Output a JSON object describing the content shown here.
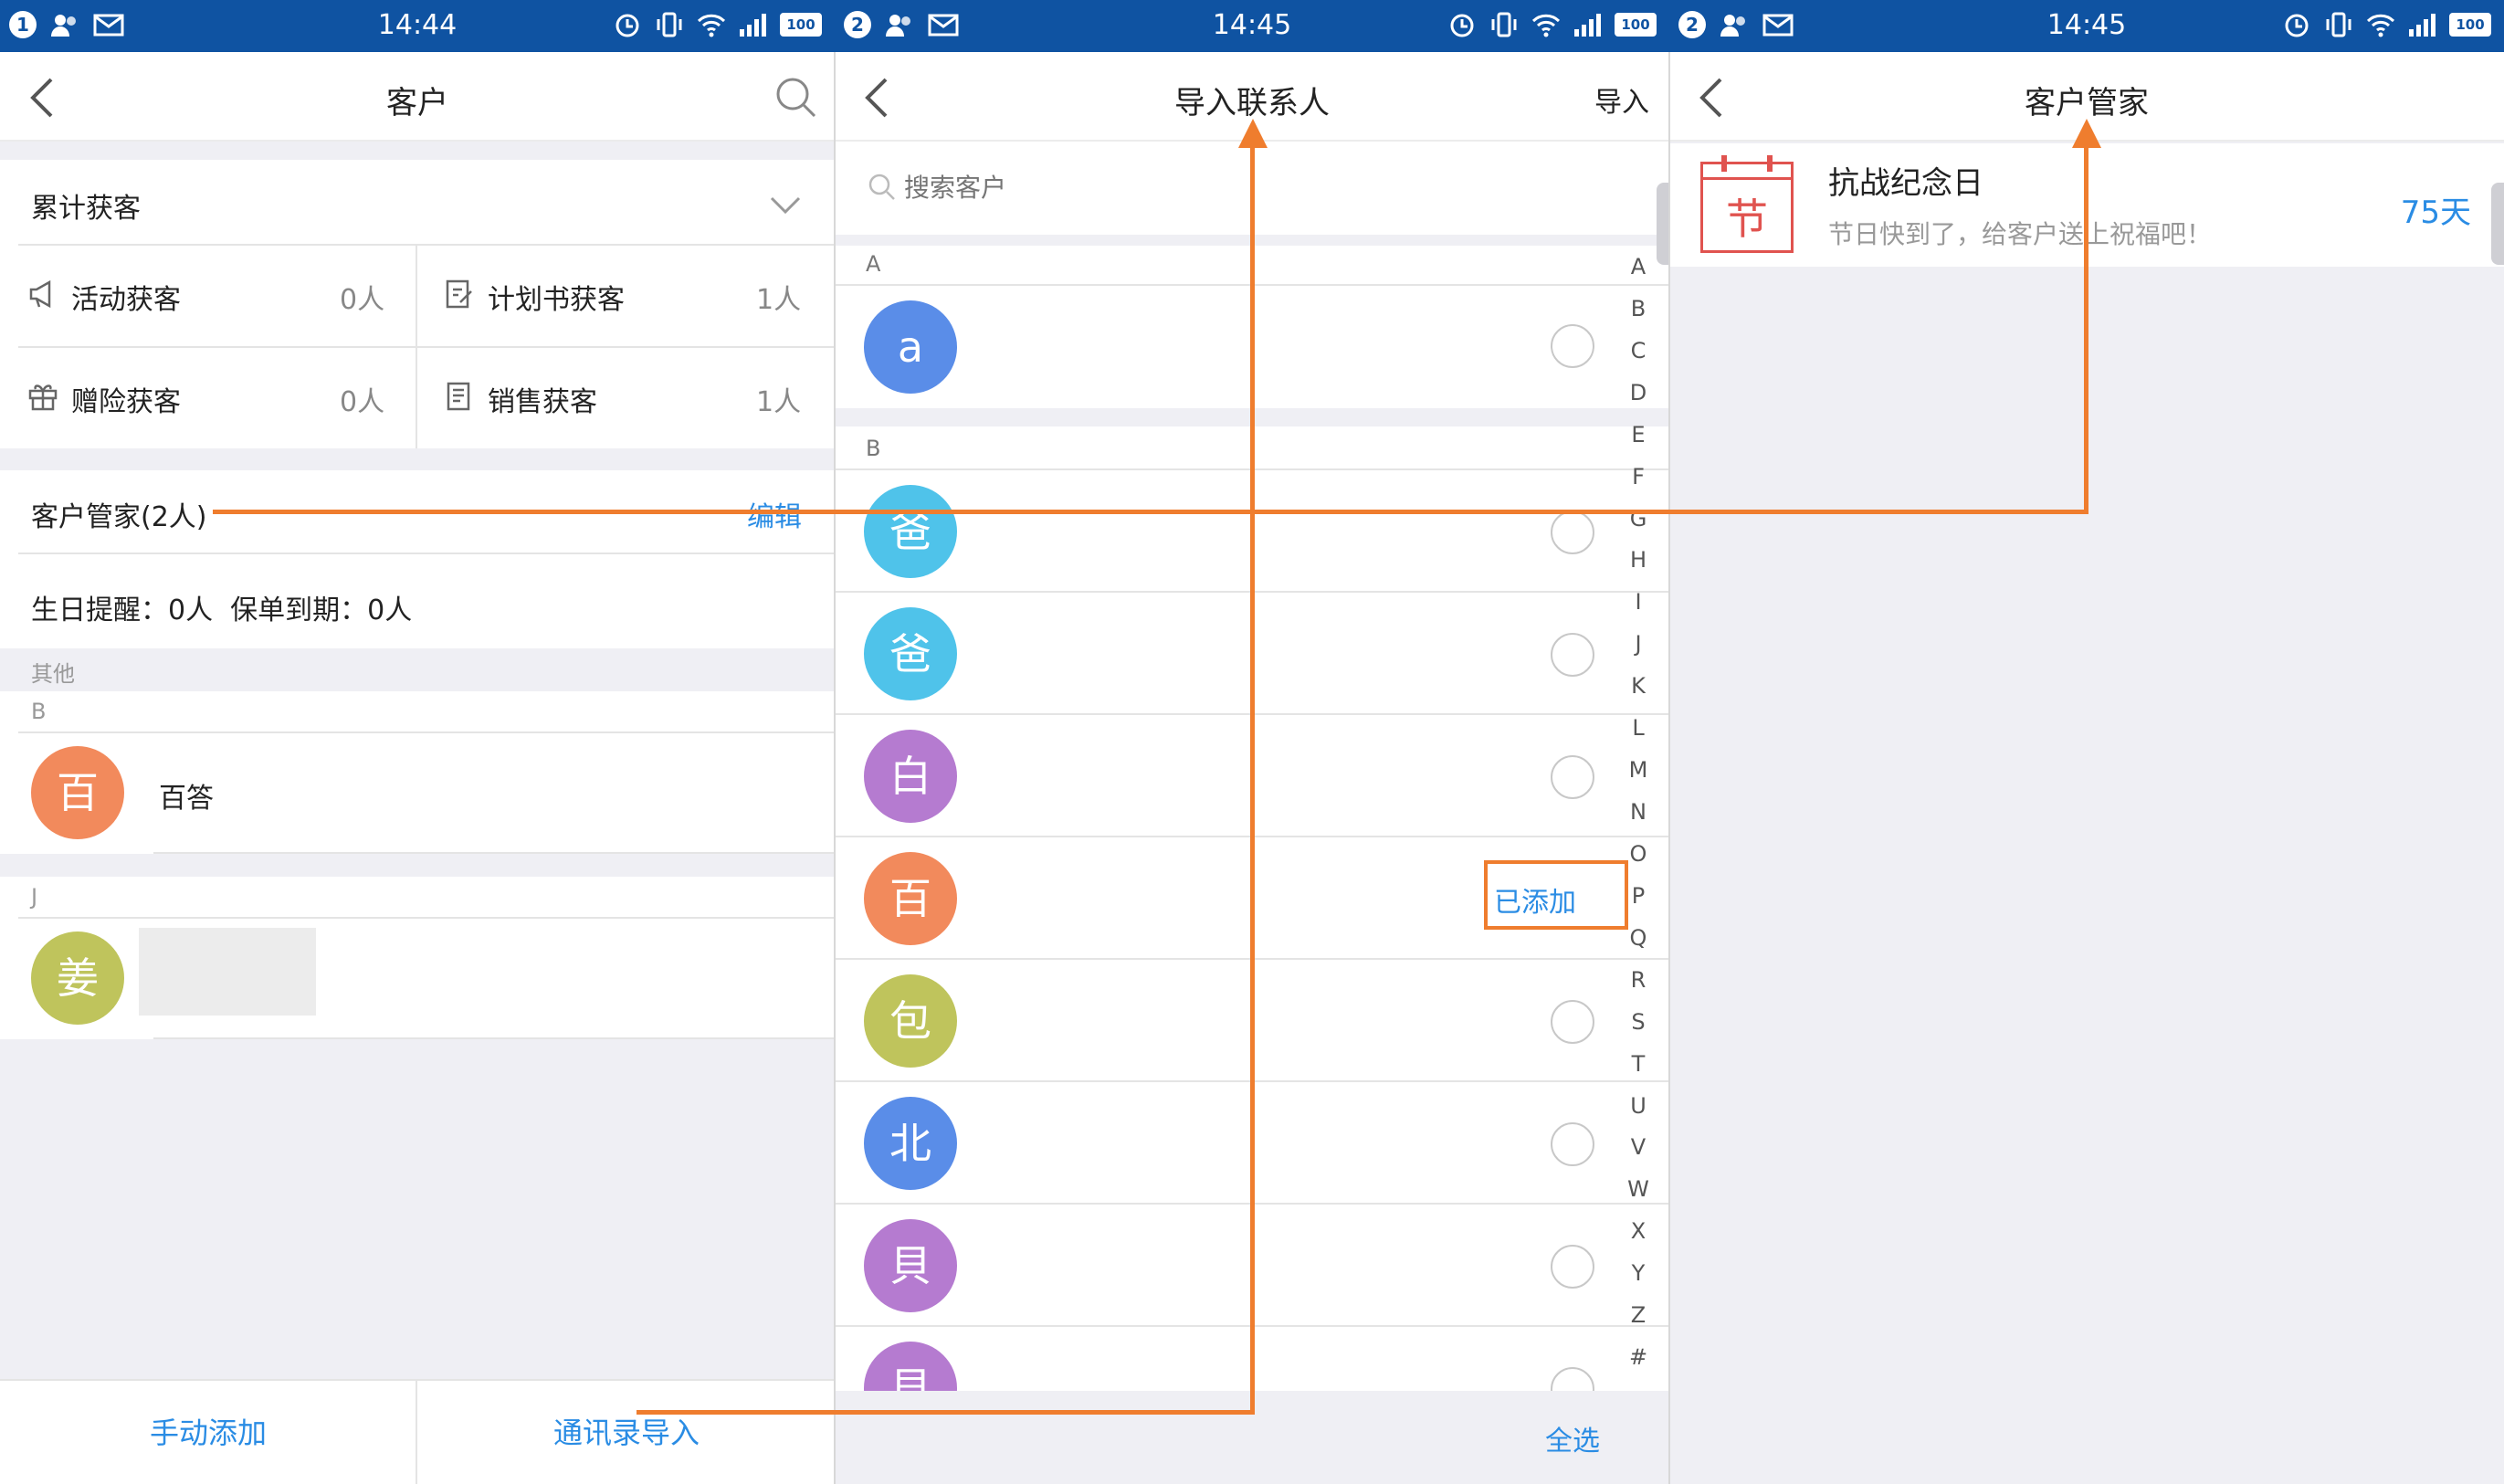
{
  "status_bars": [
    {
      "sim": "1",
      "time": "14:44",
      "battery": "100"
    },
    {
      "sim": "2",
      "time": "14:45",
      "battery": "100"
    },
    {
      "sim": "2",
      "time": "14:45",
      "battery": "100"
    }
  ],
  "panel1": {
    "title": "客户",
    "cumulative": {
      "label": "累计获客"
    },
    "stats": [
      {
        "label": "活动获客",
        "value": "0人",
        "icon": "megaphone-icon"
      },
      {
        "label": "计划书获客",
        "value": "1人",
        "icon": "edit-doc-icon"
      },
      {
        "label": "赠险获客",
        "value": "0人",
        "icon": "gift-icon"
      },
      {
        "label": "销售获客",
        "value": "1人",
        "icon": "document-icon"
      }
    ],
    "manager": {
      "label": "客户管家(2人)",
      "edit": "编辑",
      "summary": "生日提醒：0人  保单到期：0人"
    },
    "other_header": "其他",
    "groups": [
      {
        "letter": "B",
        "avatar": "百",
        "name": "百答",
        "color": "#f28a5c"
      },
      {
        "letter": "J",
        "avatar": "姜",
        "name": "",
        "color": "#bfc45c"
      }
    ],
    "bottom": {
      "manual_add": "手动添加",
      "import_contacts": "通讯录导入"
    }
  },
  "panel2": {
    "title": "导入联系人",
    "import_button": "导入",
    "search_placeholder": "搜索客户",
    "sections": [
      {
        "letter": "A",
        "contacts": [
          {
            "avatar": "a",
            "color": "#5a8de8",
            "added": false
          }
        ]
      },
      {
        "letter": "B",
        "contacts": [
          {
            "avatar": "爸",
            "color": "#4fc3ea",
            "added": false
          },
          {
            "avatar": "爸",
            "color": "#4fc3ea",
            "added": false
          },
          {
            "avatar": "白",
            "color": "#b57bd0",
            "added": false
          },
          {
            "avatar": "百",
            "color": "#f28a5c",
            "added": true
          },
          {
            "avatar": "包",
            "color": "#bfc45c",
            "added": false
          },
          {
            "avatar": "北",
            "color": "#5a8de8",
            "added": false
          },
          {
            "avatar": "貝",
            "color": "#b57bd0",
            "added": false
          },
          {
            "avatar": "貝",
            "color": "#b57bd0",
            "added": false
          }
        ]
      }
    ],
    "added_label": "已添加",
    "index": [
      "A",
      "B",
      "C",
      "D",
      "E",
      "F",
      "G",
      "H",
      "I",
      "J",
      "K",
      "L",
      "M",
      "N",
      "O",
      "P",
      "Q",
      "R",
      "S",
      "T",
      "U",
      "V",
      "W",
      "X",
      "Y",
      "Z",
      "#"
    ],
    "select_all": "全选"
  },
  "panel3": {
    "title": "客户管家",
    "reminder": {
      "icon_char": "节",
      "title": "抗战纪念日",
      "subtitle": "节日快到了，给客户送上祝福吧！",
      "days": "75天"
    }
  },
  "colors": {
    "status_bar": "#0f53a2",
    "accent_blue": "#2a8ce4",
    "annotation_orange": "#ef7d2e",
    "page_grey": "#efeff4"
  }
}
